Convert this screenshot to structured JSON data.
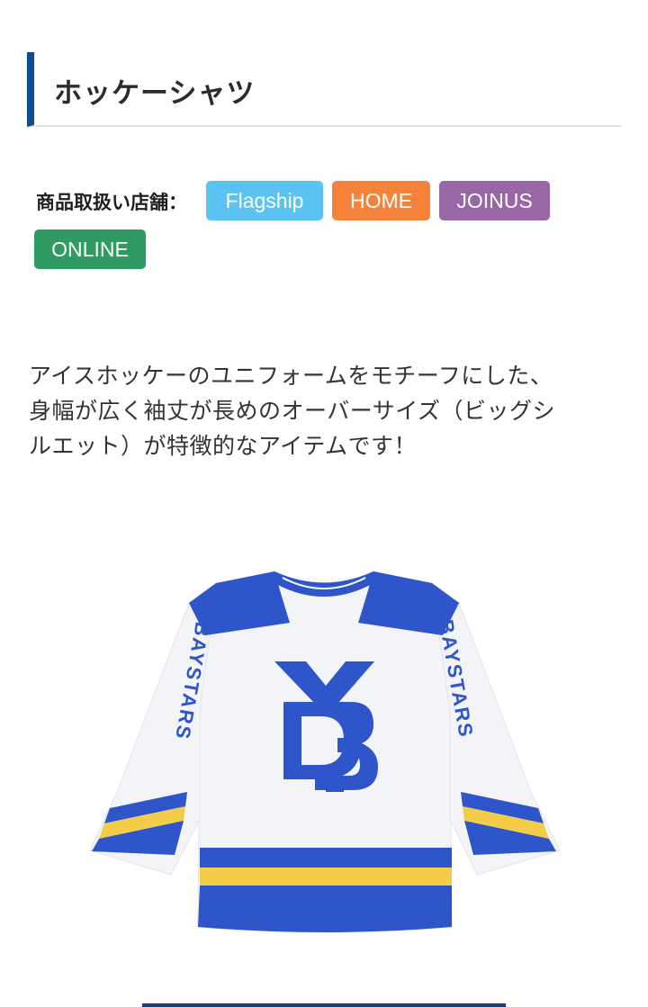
{
  "title": "ホッケーシャツ",
  "stores": {
    "label": "商品取扱い店舗：",
    "badges": [
      {
        "label": "Flagship",
        "color": "#5bc3f2"
      },
      {
        "label": "HOME",
        "color": "#f5843a"
      },
      {
        "label": "JOINUS",
        "color": "#9a67a6"
      },
      {
        "label": "ONLINE",
        "color": "#2f9b63"
      }
    ]
  },
  "description": {
    "line1": "アイスホッケーのユニフォームをモチーフにした、",
    "line2": "身幅が広く袖丈が長めのオーバーサイズ（ビッグシ",
    "line3": "ルエット）が特徴的なアイテムです！"
  },
  "product_image": {
    "logo": "YB",
    "sleeve_text": "BAYSTARS",
    "colors": {
      "blue": "#2e55c9",
      "white": "#f2f4f8",
      "yellow": "#f3cd4a"
    }
  }
}
